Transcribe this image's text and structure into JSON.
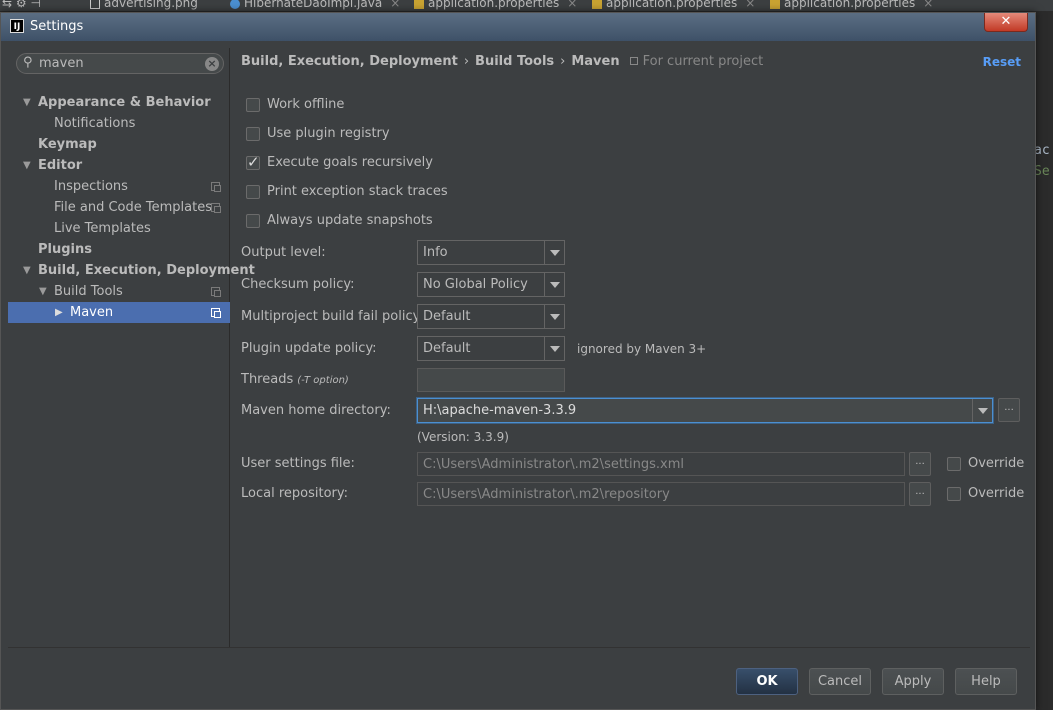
{
  "ide": {
    "tabs": [
      {
        "label": "advertising.png",
        "icon": "image-file-icon"
      },
      {
        "label": "HibernateDaoImpl.java",
        "icon": "java-class-icon"
      },
      {
        "label": "application.properties",
        "icon": "properties-file-icon"
      },
      {
        "label": "application.properties",
        "icon": "properties-file-icon"
      },
      {
        "label": "application.properties",
        "icon": "properties-file-icon"
      }
    ],
    "background_text": [
      "ac",
      "Se"
    ]
  },
  "dialog": {
    "title": "Settings",
    "app_icon_text": "IJ",
    "close_glyph": "✕"
  },
  "search": {
    "value": "maven",
    "search_glyph": "⚲",
    "clear_glyph": "×"
  },
  "sidebar": {
    "expand_glyph": "▼",
    "collapse_glyph": "▶",
    "items": [
      {
        "label": "Appearance & Behavior",
        "level": 0,
        "expanded": true,
        "bold": true
      },
      {
        "label": "Notifications",
        "level": 1
      },
      {
        "label": "Keymap",
        "level": 0,
        "bold": true
      },
      {
        "label": "Editor",
        "level": 0,
        "expanded": true,
        "bold": true
      },
      {
        "label": "Inspections",
        "level": 1,
        "project_icon": true
      },
      {
        "label": "File and Code Templates",
        "level": 1,
        "project_icon": true
      },
      {
        "label": "Live Templates",
        "level": 1
      },
      {
        "label": "Plugins",
        "level": 0,
        "bold": true
      },
      {
        "label": "Build, Execution, Deployment",
        "level": 0,
        "expanded": true,
        "bold": true
      },
      {
        "label": "Build Tools",
        "level": 1,
        "expanded": true,
        "project_icon": true
      },
      {
        "label": "Maven",
        "level": 2,
        "collapsed": true,
        "project_icon": true,
        "selected": true
      }
    ]
  },
  "breadcrumb": {
    "parts": [
      "Build, Execution, Deployment",
      "Build Tools",
      "Maven"
    ],
    "separator": "›",
    "scope": "For current project",
    "reset_label": "Reset"
  },
  "options": {
    "work_offline": {
      "label": "Work offline",
      "checked": false
    },
    "use_plugin_registry": {
      "label": "Use plugin registry",
      "checked": false
    },
    "execute_goals_recursively": {
      "label": "Execute goals recursively",
      "checked": true
    },
    "print_exception_stack_traces": {
      "label": "Print exception stack traces",
      "checked": false
    },
    "always_update_snapshots": {
      "label": "Always update snapshots",
      "checked": false
    }
  },
  "form": {
    "output_level": {
      "label": "Output level:",
      "value": "Info"
    },
    "checksum_policy": {
      "label": "Checksum policy:",
      "value": "No Global Policy"
    },
    "multiproject_fail_policy": {
      "label": "Multiproject build fail policy:",
      "value": "Default"
    },
    "plugin_update_policy": {
      "label": "Plugin update policy:",
      "value": "Default",
      "note": "ignored by Maven 3+"
    },
    "threads": {
      "label": "Threads",
      "hint": "(-T option)",
      "value": ""
    },
    "maven_home": {
      "label": "Maven home directory:",
      "value": "H:\\apache-maven-3.3.9",
      "version": "(Version: 3.3.9)"
    },
    "user_settings": {
      "label": "User settings file:",
      "value": "C:\\Users\\Administrator\\.m2\\settings.xml",
      "override_label": "Override",
      "override_checked": false
    },
    "local_repository": {
      "label": "Local repository:",
      "value": "C:\\Users\\Administrator\\.m2\\repository",
      "override_label": "Override",
      "override_checked": false
    },
    "browse_glyph": "..."
  },
  "footer": {
    "ok_label": "OK",
    "cancel_label": "Cancel",
    "apply_label": "Apply",
    "help_label": "Help"
  },
  "colors": {
    "background": "#3c3f41",
    "selection": "#4b6eaf",
    "link": "#589df6",
    "focus": "#4b8fd1"
  }
}
